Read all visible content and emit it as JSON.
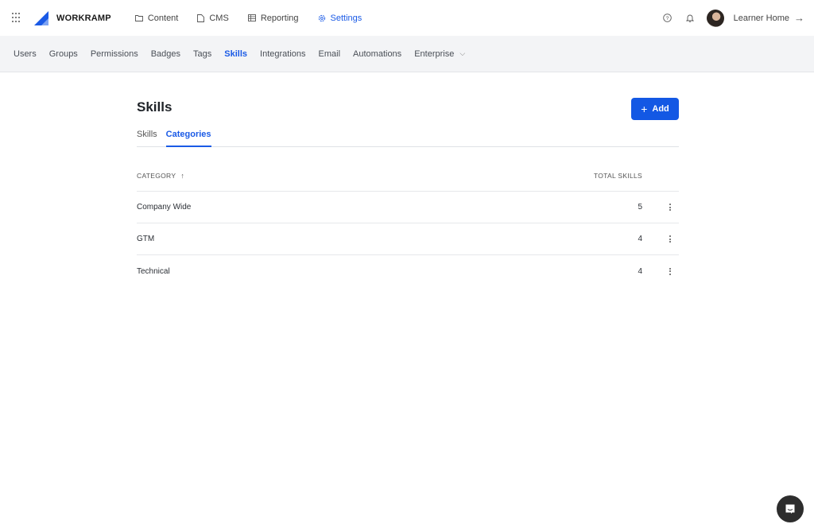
{
  "topbar": {
    "brand": "WORKRAMP",
    "nav": [
      {
        "label": "Content",
        "icon": "folder-icon",
        "active": false
      },
      {
        "label": "CMS",
        "icon": "document-icon",
        "active": false
      },
      {
        "label": "Reporting",
        "icon": "table-icon",
        "active": false
      },
      {
        "label": "Settings",
        "icon": "gear-icon",
        "active": true
      }
    ],
    "learner_home": "Learner Home",
    "arrow": "→"
  },
  "subnav": {
    "items": [
      {
        "label": "Users"
      },
      {
        "label": "Groups"
      },
      {
        "label": "Permissions"
      },
      {
        "label": "Badges"
      },
      {
        "label": "Tags"
      },
      {
        "label": "Skills",
        "active": true
      },
      {
        "label": "Integrations"
      },
      {
        "label": "Email"
      },
      {
        "label": "Automations"
      },
      {
        "label": "Enterprise",
        "dropdown": true
      }
    ],
    "chevron": "⌵"
  },
  "page": {
    "title": "Skills",
    "add_button": {
      "plus": "+",
      "label": "Add"
    },
    "tabs": [
      {
        "label": "Skills",
        "active": false
      },
      {
        "label": "Categories",
        "active": true
      }
    ],
    "table": {
      "columns": {
        "category": "CATEGORY",
        "sort_icon": "↑",
        "total": "TOTAL SKILLS"
      },
      "rows": [
        {
          "category": "Company Wide",
          "total": "5"
        },
        {
          "category": "GTM",
          "total": "4"
        },
        {
          "category": "Technical",
          "total": "4"
        }
      ]
    }
  },
  "colors": {
    "accent": "#1358e4",
    "subnav_bg": "#f3f4f6",
    "chat_bg": "#2d2d2d"
  }
}
